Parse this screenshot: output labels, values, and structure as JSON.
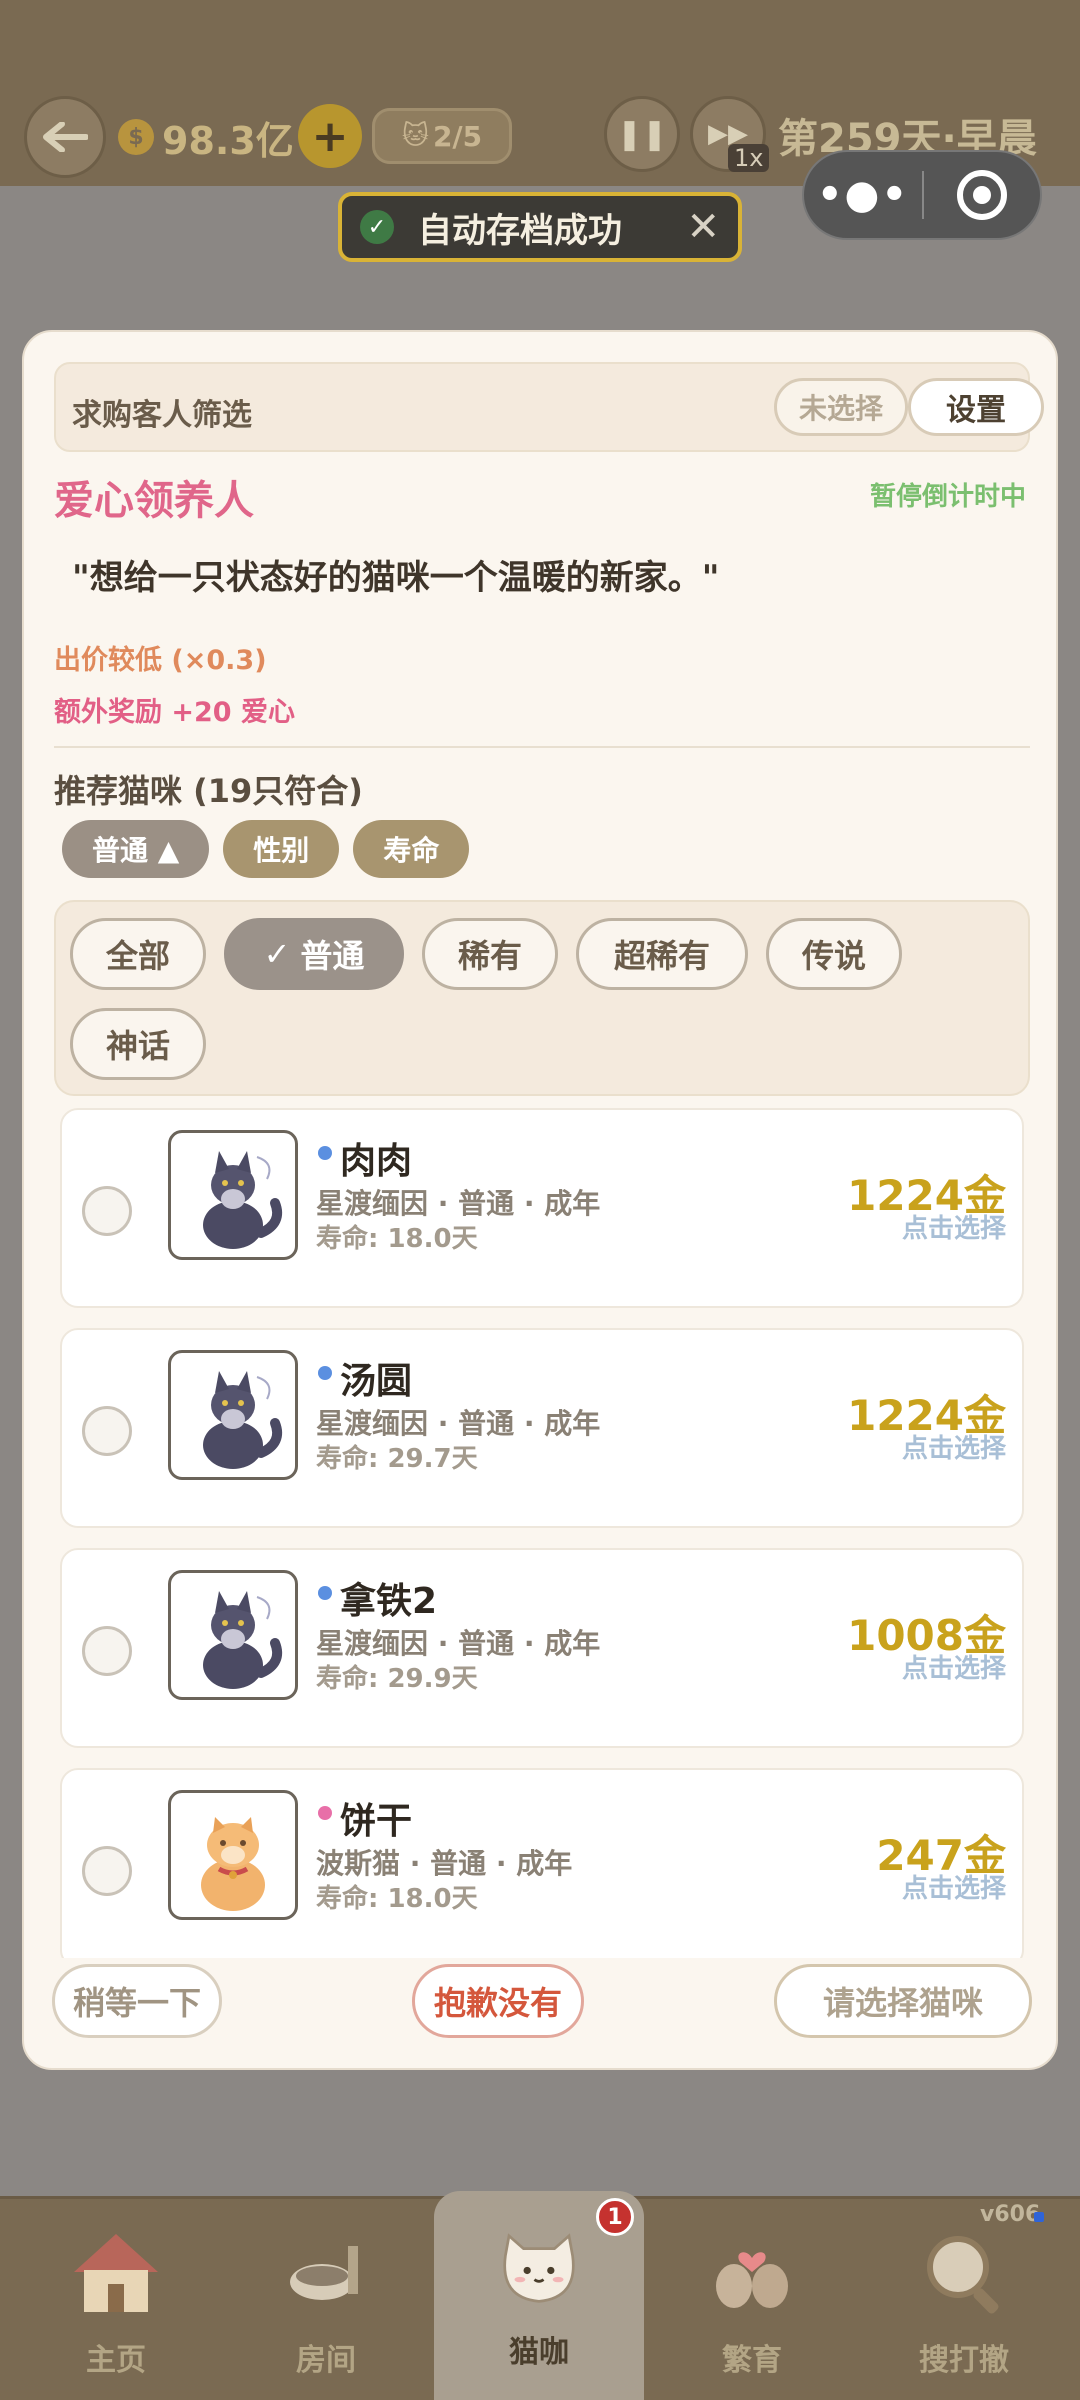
{
  "topbar": {
    "money": "98.3亿",
    "cat_capacity": "2/5",
    "speed": "1x",
    "day_label": "第259天·早晨"
  },
  "toast": {
    "text": "自动存档成功"
  },
  "dialog": {
    "filter_label": "求购客人筛选",
    "filter_unselected": "未选择",
    "filter_settings": "设置",
    "customer_name": "爱心领养人",
    "timer_note": "暂停倒计时中",
    "quote": "\"想给一只状态好的猫咪一个温暖的新家。\"",
    "price_note": "出价较低 (×0.3)",
    "bonus_note": "额外奖励 +20 爱心",
    "recommend_title": "推荐猫咪 (19只符合)",
    "sort_chips": [
      "普通 ▲",
      "性别",
      "寿命"
    ],
    "rarity_chips": [
      "全部",
      "普通",
      "稀有",
      "超稀有",
      "传说",
      "神话"
    ],
    "rarity_selected_index": 1,
    "cats": [
      {
        "name": "肉肉",
        "meta": "星渡缅因 · 普通 · 成年",
        "life": "寿命: 18.0天",
        "price": "1224金",
        "pick": "点击选择",
        "dot_color": "#5b8fe0"
      },
      {
        "name": "汤圆",
        "meta": "星渡缅因 · 普通 · 成年",
        "life": "寿命: 29.7天",
        "price": "1224金",
        "pick": "点击选择",
        "dot_color": "#5b8fe0"
      },
      {
        "name": "拿铁2",
        "meta": "星渡缅因 · 普通 · 成年",
        "life": "寿命: 29.9天",
        "price": "1008金",
        "pick": "点击选择",
        "dot_color": "#5b8fe0"
      },
      {
        "name": "饼干",
        "meta": "波斯猫 · 普通 · 成年",
        "life": "寿命: 18.0天",
        "price": "247金",
        "pick": "点击选择",
        "dot_color": "#e86fa8"
      }
    ],
    "btn_wait": "稍等一下",
    "btn_sorry": "抱歉没有",
    "btn_choose": "请选择猫咪"
  },
  "bottom_nav": {
    "items": [
      "主页",
      "房间",
      "猫咖",
      "繁育",
      "搜打撤"
    ],
    "active_index": 2,
    "badge": "1",
    "version": "v606"
  }
}
